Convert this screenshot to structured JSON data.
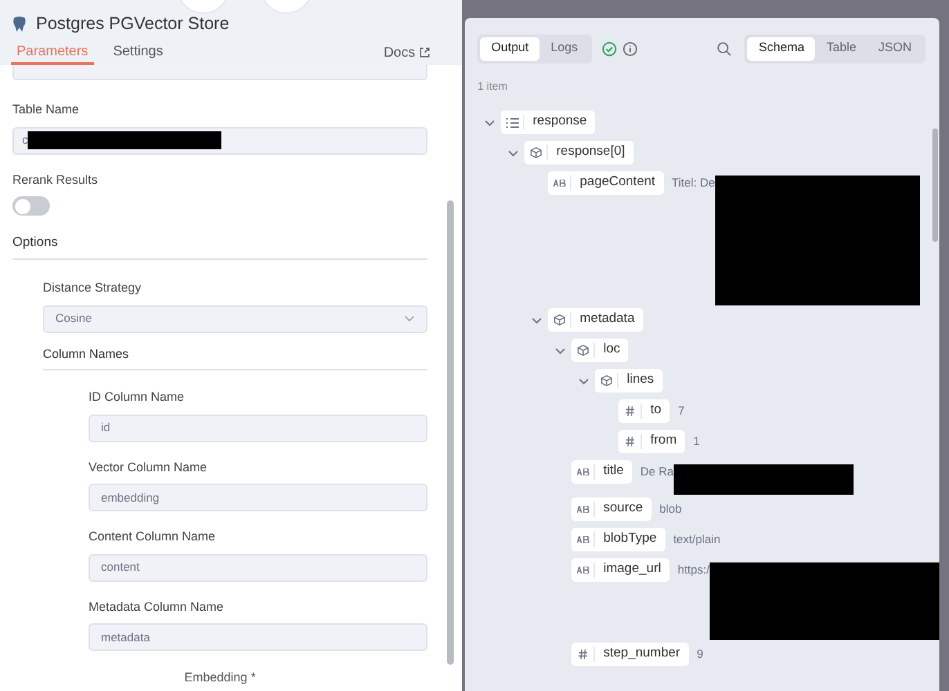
{
  "header": {
    "title": "Postgres PGVector Store",
    "tabs": [
      {
        "label": "Parameters",
        "selected": true
      },
      {
        "label": "Settings",
        "selected": false
      }
    ],
    "docs": "Docs"
  },
  "params": {
    "table_name": {
      "label": "Table Name",
      "value": "c",
      "redacted": true
    },
    "rerank": {
      "label": "Rerank Results",
      "on": false
    },
    "options_title": "Options",
    "distance": {
      "label": "Distance Strategy",
      "value": "Cosine"
    },
    "column_names_title": "Column Names",
    "columns": [
      {
        "label": "ID Column Name",
        "value": "id"
      },
      {
        "label": "Vector Column Name",
        "value": "embedding"
      },
      {
        "label": "Content Column Name",
        "value": "content"
      },
      {
        "label": "Metadata Column Name",
        "value": "metadata"
      }
    ]
  },
  "footer_label": "Embedding *",
  "output": {
    "tabs": [
      {
        "label": "Output",
        "selected": true
      },
      {
        "label": "Logs",
        "selected": false
      }
    ],
    "views": [
      {
        "label": "Schema",
        "selected": true
      },
      {
        "label": "Table",
        "selected": false
      },
      {
        "label": "JSON",
        "selected": false
      }
    ],
    "item_count": "1 item",
    "tree": [
      {
        "key": "response",
        "kind": "array",
        "expanded": true,
        "children": [
          {
            "key": "response[0]",
            "kind": "object",
            "expanded": true,
            "children": [
              {
                "key": "pageContent",
                "kind": "string",
                "value": "Titel: De",
                "redacted": true
              },
              {
                "key": "metadata",
                "kind": "object",
                "expanded": true,
                "children": [
                  {
                    "key": "loc",
                    "kind": "object",
                    "expanded": true,
                    "children": [
                      {
                        "key": "lines",
                        "kind": "object",
                        "expanded": true,
                        "children": [
                          {
                            "key": "to",
                            "kind": "number",
                            "value": "7"
                          },
                          {
                            "key": "from",
                            "kind": "number",
                            "value": "1"
                          }
                        ]
                      }
                    ]
                  },
                  {
                    "key": "title",
                    "kind": "string",
                    "value": "De Ra",
                    "redacted": true
                  },
                  {
                    "key": "source",
                    "kind": "string",
                    "value": "blob"
                  },
                  {
                    "key": "blobType",
                    "kind": "string",
                    "value": "text/plain"
                  },
                  {
                    "key": "image_url",
                    "kind": "string",
                    "value": "https:/",
                    "redacted": true
                  },
                  {
                    "key": "step_number",
                    "kind": "number",
                    "value": "9"
                  }
                ]
              }
            ]
          }
        ]
      }
    ]
  }
}
